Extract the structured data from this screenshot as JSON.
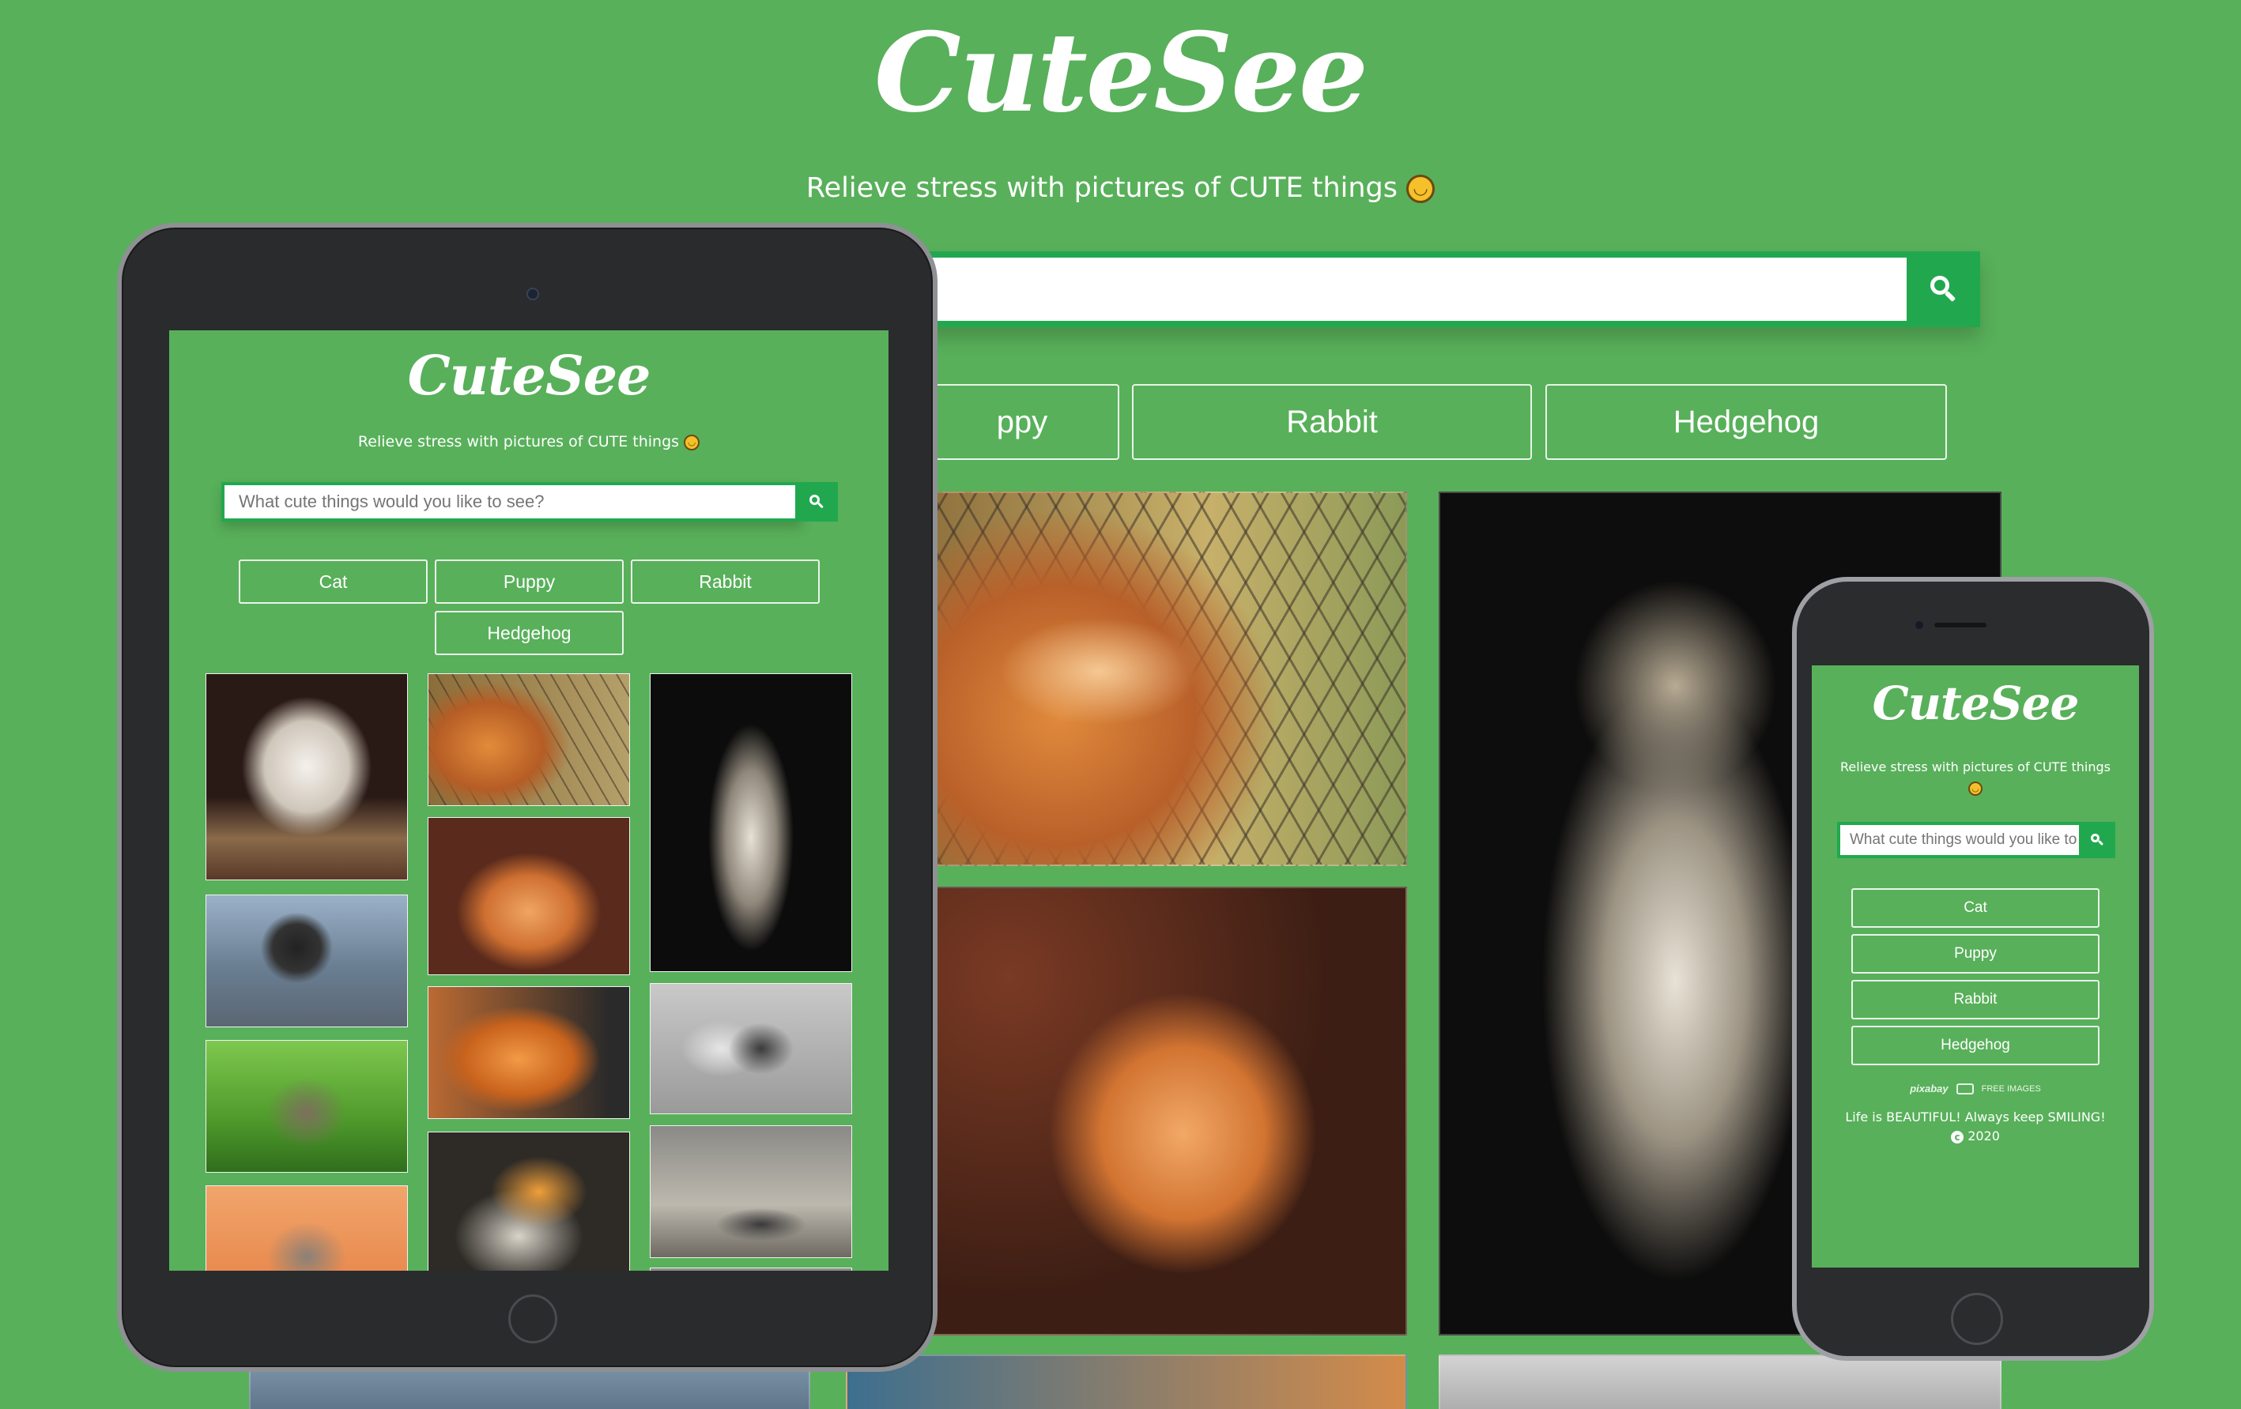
{
  "app": {
    "brand": "CuteSee",
    "tagline": "Relieve stress with pictures of CUTE things",
    "emoji": "smiling-face-icon"
  },
  "desktop": {
    "categories": [
      "ppy",
      "Rabbit",
      "Hedgehog"
    ]
  },
  "tablet": {
    "search_placeholder": "What cute things would you like to see?",
    "categories": [
      "Cat",
      "Puppy",
      "Rabbit",
      "Hedgehog"
    ]
  },
  "phone": {
    "search_placeholder": "What cute things would you like to see?",
    "categories": [
      "Cat",
      "Puppy",
      "Rabbit",
      "Hedgehog"
    ],
    "credit_provider": "pixabay",
    "credit_label": "FREE IMAGES",
    "footer_line": "Life is BEAUTIFUL! Always keep SMILING!",
    "footer_year": "2020"
  },
  "colors": {
    "background": "#58b05a",
    "accent": "#21a84f"
  }
}
